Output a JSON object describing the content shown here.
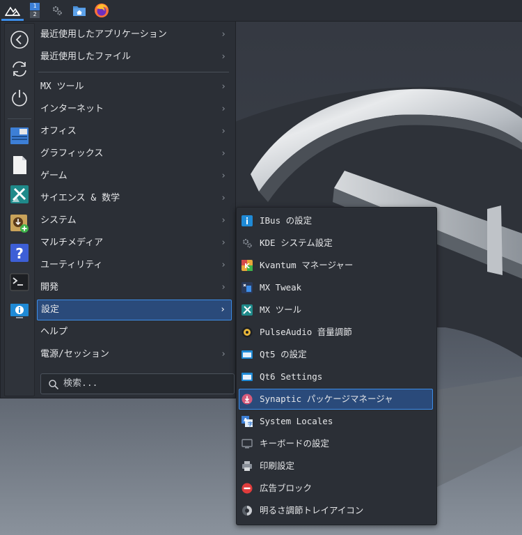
{
  "panel": {
    "pager": [
      "1",
      "2"
    ]
  },
  "menu": {
    "categories": [
      {
        "label": "最近使用したアプリケーション"
      },
      {
        "label": "最近使用したファイル"
      },
      {
        "label": "MX ツール"
      },
      {
        "label": "インターネット"
      },
      {
        "label": "オフィス"
      },
      {
        "label": "グラフィックス"
      },
      {
        "label": "ゲーム"
      },
      {
        "label": "サイエンス & 数学"
      },
      {
        "label": "システム"
      },
      {
        "label": "マルチメディア"
      },
      {
        "label": "ユーティリティ"
      },
      {
        "label": "開発"
      },
      {
        "label": "設定"
      },
      {
        "label": "ヘルプ"
      },
      {
        "label": "電源/セッション"
      }
    ],
    "selected_category": "設定",
    "arrow": "›",
    "search_placeholder": "検索..."
  },
  "submenu": {
    "items": [
      {
        "label": "IBus の設定",
        "icon": "info-icon"
      },
      {
        "label": "KDE システム設定",
        "icon": "gears-icon"
      },
      {
        "label": "Kvantum マネージャー",
        "icon": "kvantum-icon"
      },
      {
        "label": "MX Tweak",
        "icon": "mx-tweak-icon"
      },
      {
        "label": "MX ツール",
        "icon": "mx-tools-icon"
      },
      {
        "label": "PulseAudio 音量調節",
        "icon": "speaker-icon"
      },
      {
        "label": "Qt5 の設定",
        "icon": "window-icon"
      },
      {
        "label": "Qt6 Settings",
        "icon": "window-icon"
      },
      {
        "label": "Synaptic パッケージマネージャ",
        "icon": "synaptic-icon"
      },
      {
        "label": "System Locales",
        "icon": "locale-icon"
      },
      {
        "label": "キーボードの設定",
        "icon": "monitor-icon"
      },
      {
        "label": "印刷設定",
        "icon": "printer-icon"
      },
      {
        "label": "広告ブロック",
        "icon": "block-icon"
      },
      {
        "label": "明るさ調節トレイアイコン",
        "icon": "brightness-icon"
      }
    ],
    "selected": "Synaptic パッケージマネージャ"
  },
  "colors": {
    "accent": "#3d8ee9",
    "selection": "#2a4a7a",
    "menu_bg": "#2b2f36"
  }
}
